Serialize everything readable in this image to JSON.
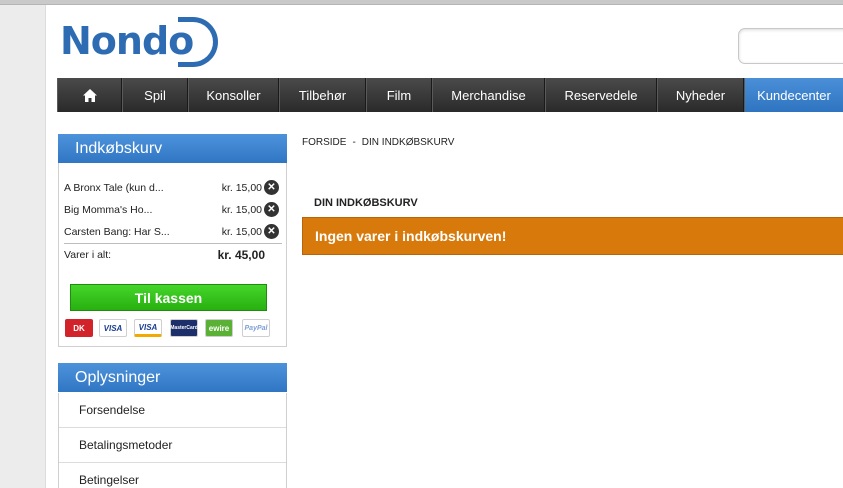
{
  "header": {
    "logo_text": "Nondo",
    "search_placeholder": ""
  },
  "nav": {
    "items": [
      "Spil",
      "Konsoller",
      "Tilbehør",
      "Film",
      "Merchandise",
      "Reservedele",
      "Nyheder",
      "Kundecenter"
    ],
    "active": "Kundecenter",
    "accent": "#3a80cc"
  },
  "cart": {
    "title": "Indkøbskurv",
    "items": [
      {
        "name": "A Bronx Tale (kun d...",
        "price": "kr. 15,00"
      },
      {
        "name": "Big Momma's Ho...",
        "price": "kr. 15,00"
      },
      {
        "name": "Carsten Bang: Har S...",
        "price": "kr. 15,00"
      }
    ],
    "total_label": "Varer i alt:",
    "total_value": "kr. 45,00",
    "checkout_label": "Til kassen",
    "payment_methods": [
      "DK",
      "VISA",
      "VISA",
      "MasterCard",
      "ewire",
      "PayPal"
    ]
  },
  "info": {
    "title": "Oplysninger",
    "items": [
      "Forsendelse",
      "Betalingsmetoder",
      "Betingelser"
    ]
  },
  "breadcrumb": {
    "home": "FORSIDE",
    "separator": "-",
    "current": "DIN INDKØBSKURV"
  },
  "main": {
    "title": "DIN INDKØBSKURV",
    "empty_message": "Ingen varer i indkøbskurven!",
    "message_color": "#d87a0b"
  }
}
